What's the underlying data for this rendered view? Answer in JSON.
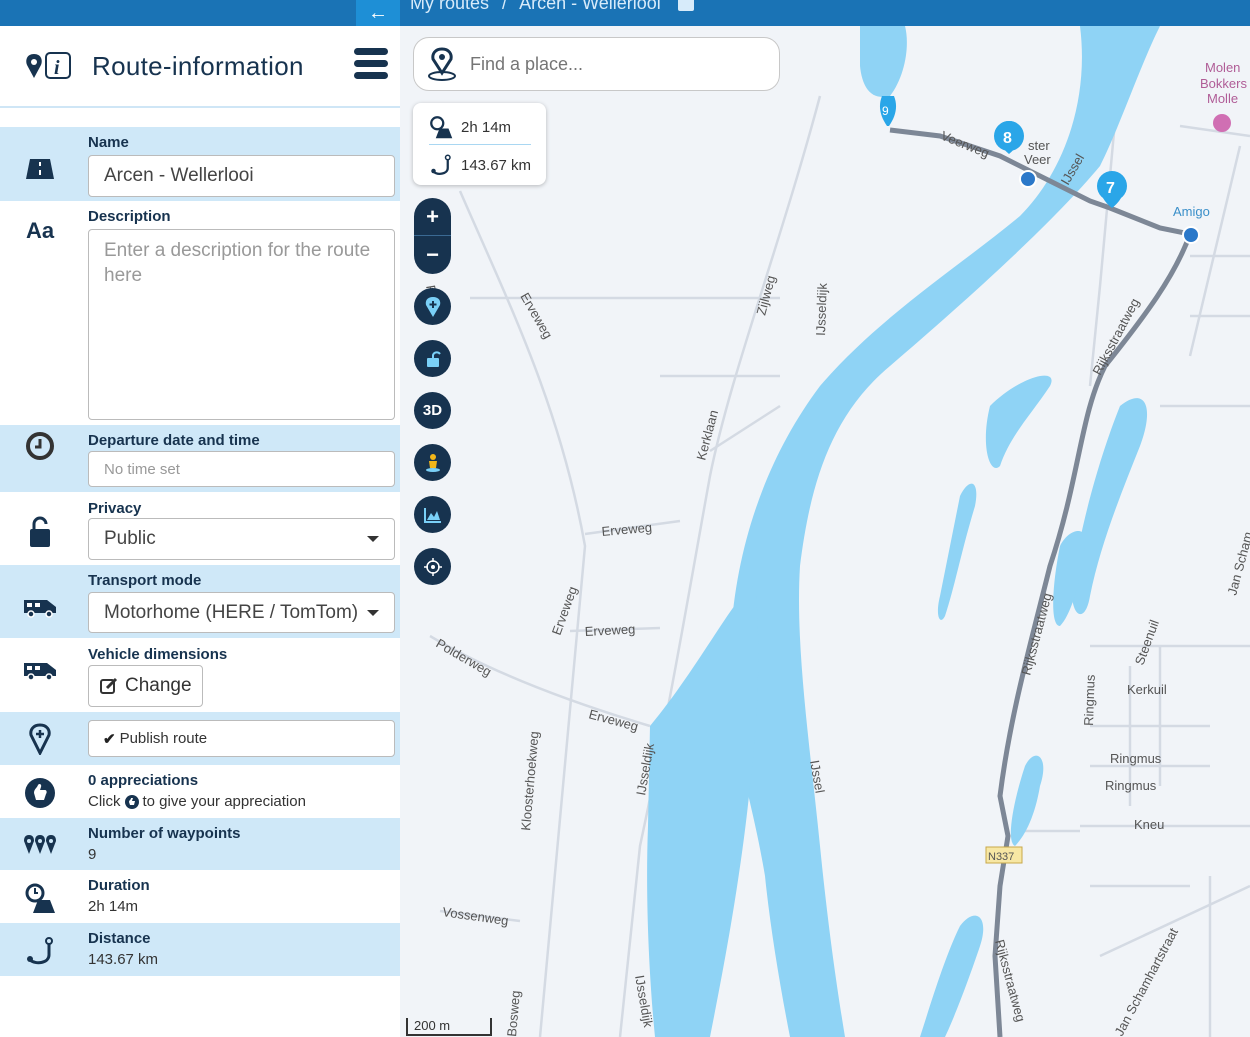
{
  "topbar": {
    "breadcrumb_root": "My routes",
    "breadcrumb_sep": "/",
    "breadcrumb_current": "Arcen - Wellerlooi"
  },
  "sidebar": {
    "title": "Route-information",
    "name": {
      "label": "Name",
      "value": "Arcen - Wellerlooi"
    },
    "description": {
      "label": "Description",
      "placeholder": "Enter a description for the route here"
    },
    "departure": {
      "label": "Departure date and time",
      "placeholder": "No time set"
    },
    "privacy": {
      "label": "Privacy",
      "value": "Public"
    },
    "transport": {
      "label": "Transport mode",
      "value": "Motorhome (HERE / TomTom)"
    },
    "vehicle": {
      "label": "Vehicle dimensions",
      "button": "Change"
    },
    "publish": {
      "button": "Publish route"
    },
    "appreciations": {
      "label": "0 appreciations",
      "text_before": "Click",
      "text_after": "to give your appreciation"
    },
    "waypoints": {
      "label": "Number of waypoints",
      "value": "9"
    },
    "duration": {
      "label": "Duration",
      "value": "2h 14m"
    },
    "distance": {
      "label": "Distance",
      "value": "143.67 km"
    }
  },
  "map": {
    "search_placeholder": "Find a place...",
    "stats_duration": "2h 14m",
    "stats_distance": "143.67 km",
    "zoom_in": "+",
    "zoom_out": "−",
    "btn_3d": "3D",
    "scale": "200 m",
    "markers": [
      "9",
      "8",
      "7"
    ],
    "labels": {
      "veerweg": "Veerweg",
      "sterveer1": "ster",
      "sterveer2": "Veer",
      "ijssel_top": "IJssel",
      "amigo": "Amigo",
      "molen1": "Molen",
      "molen2": "Bokkers",
      "molen3": "Molle",
      "rijksstraatweg1": "Rijksstraatweg",
      "rijksstraatweg2": "Rijksstraatweg",
      "rijksstraatweg3": "Rijksstraatweg",
      "erveweg1": "Erveweg",
      "erveweg2": "Erveweg",
      "erveweg3": "Erveweg",
      "erveweg4": "Erveweg",
      "erveweg5": "Erveweg",
      "zijlweg": "Zijlweg",
      "ijsseldijk1": "IJsseldijk",
      "ijsseldijk2": "IJsseldijk",
      "ijsseldijk3": "IJsseldijk",
      "kerklaan": "Kerklaan",
      "polderweg": "Polderweg",
      "kloosterhoekweg": "Kloosterhoekweg",
      "vossenweg": "Vossenweg",
      "bosweg": "Bosweg",
      "ijssel_mid": "IJssel",
      "steenuil": "Steenuil",
      "kerkuil": "Kerkuil",
      "ringmus1": "Ringmus",
      "ringmus2": "Ringmus",
      "ringmus3": "Ringmus",
      "kneu": "Kneu",
      "n337": "N337",
      "jan_scham": "Jan Scham",
      "jan_schamhartstraat": "Jan Schamhartstraat",
      "pa": "Pa"
    }
  },
  "colors": {
    "topbar": "#1a73b5",
    "row_blue": "#cfe8f8",
    "navy": "#17334f",
    "water": "#8fd3f5",
    "route": "#7d8796"
  }
}
